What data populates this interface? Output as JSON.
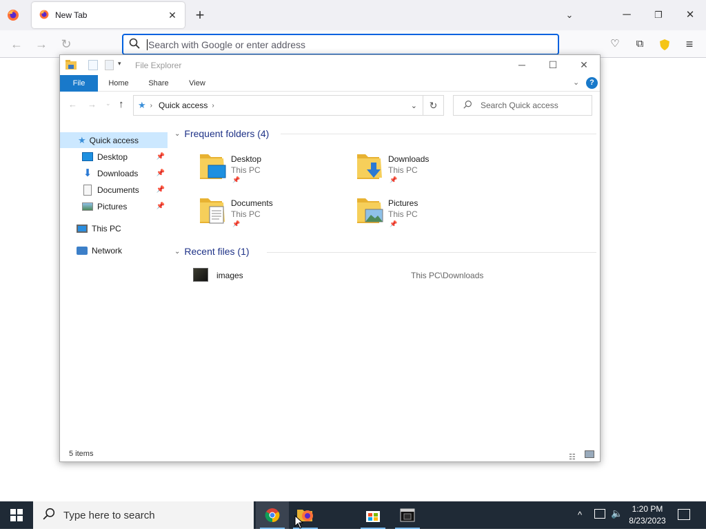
{
  "browser": {
    "tab_title": "New Tab",
    "url_placeholder": "Search with Google or enter address",
    "accent": "#0061e0"
  },
  "explorer": {
    "title": "File Explorer",
    "ribbon_tabs": [
      "File",
      "Home",
      "Share",
      "View"
    ],
    "breadcrumb": "Quick access",
    "search_placeholder": "Search Quick access",
    "nav": {
      "quick_access": "Quick access",
      "pinned": [
        "Desktop",
        "Downloads",
        "Documents",
        "Pictures"
      ],
      "this_pc": "This PC",
      "network": "Network"
    },
    "frequent_header": "Frequent folders (4)",
    "frequent": [
      {
        "name": "Desktop",
        "location": "This PC"
      },
      {
        "name": "Downloads",
        "location": "This PC"
      },
      {
        "name": "Documents",
        "location": "This PC"
      },
      {
        "name": "Pictures",
        "location": "This PC"
      }
    ],
    "recent_header": "Recent files (1)",
    "recent": [
      {
        "name": "images",
        "path": "This PC\\Downloads"
      }
    ],
    "status": "5 items",
    "accent": "#1979ca"
  },
  "taskbar": {
    "search_placeholder": "Type here to search",
    "time": "1:20 PM",
    "date": "8/23/2023"
  }
}
